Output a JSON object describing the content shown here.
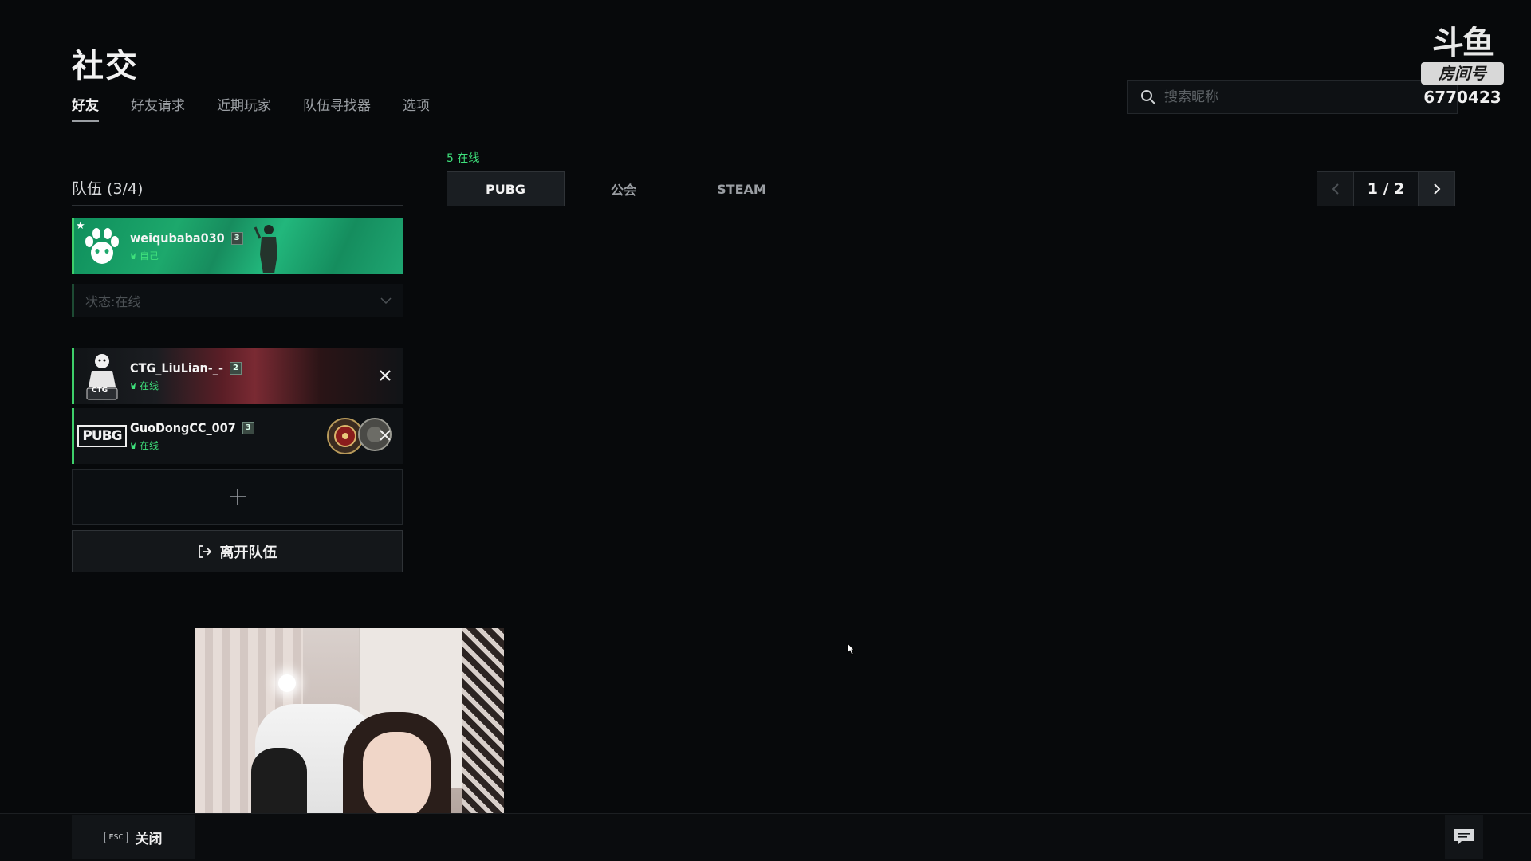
{
  "page": {
    "title": "社交"
  },
  "nav": {
    "tabs": [
      {
        "label": "好友"
      },
      {
        "label": "好友请求"
      },
      {
        "label": "近期玩家"
      },
      {
        "label": "队伍寻找器"
      },
      {
        "label": "选项"
      }
    ],
    "active_index": 0
  },
  "search": {
    "placeholder": "搜索昵称"
  },
  "watermark": {
    "logo": "斗鱼",
    "label": "房间号",
    "room": "6770423"
  },
  "team": {
    "header": "队伍 (3/4)",
    "self": {
      "name": "weiqubaba030",
      "level": "3",
      "status": "自己"
    },
    "status_dropdown": {
      "label": "状态:在线"
    },
    "members": [
      {
        "name": "CTG_LiuLian-_-",
        "level": "2",
        "status": "在线",
        "avatar_text": "CTG"
      },
      {
        "name": "GuoDongCC_007",
        "level": "3",
        "status": "在线",
        "avatar_text": "PUBG"
      }
    ],
    "leave_label": "离开队伍"
  },
  "friends": {
    "online_count": "5 在线",
    "tabs": [
      {
        "label": "PUBG"
      },
      {
        "label": "公会"
      },
      {
        "label": "STEAM"
      }
    ],
    "pager": "1 / 2"
  },
  "footer": {
    "esc_key": "ESC",
    "close_label": "关闭"
  },
  "colors": {
    "accent_green": "#3ecf6a",
    "background": "#07090b",
    "self_card": "#1da86c"
  }
}
